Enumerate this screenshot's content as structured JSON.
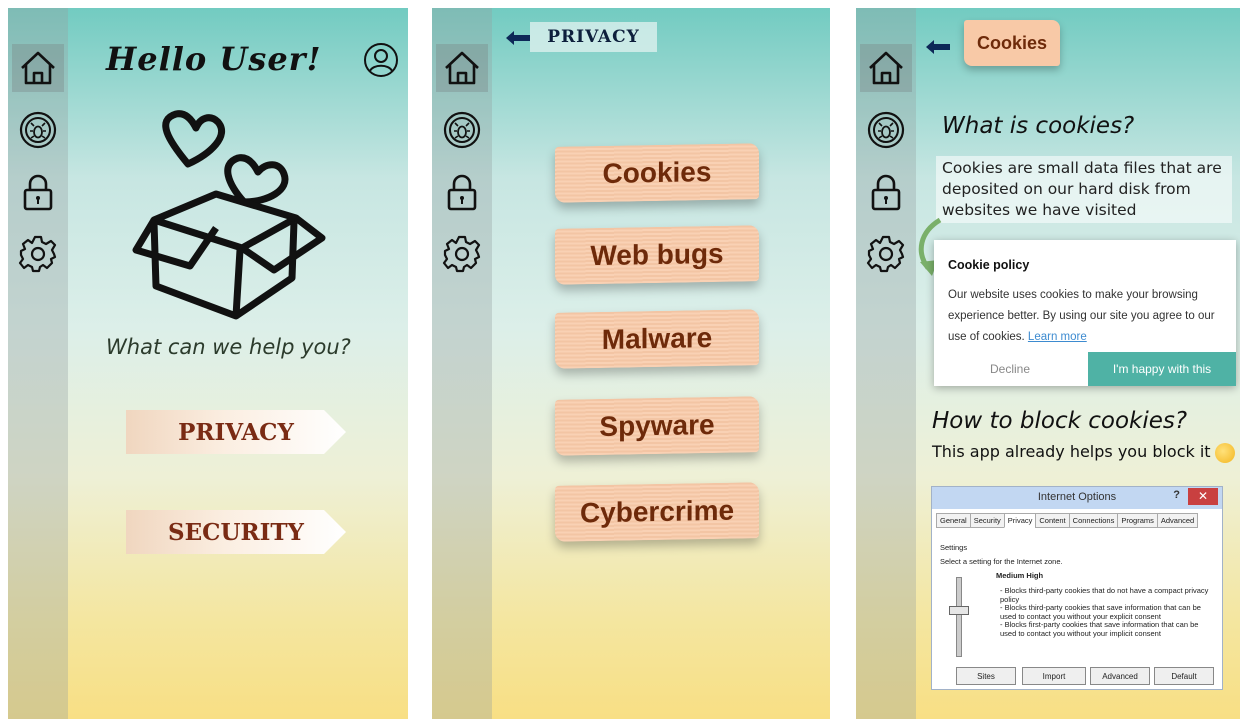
{
  "screen_home": {
    "greeting": "Hello User!",
    "help_text": "What can we help you?",
    "privacy_button": "PRIVACY",
    "security_button": "SECURITY"
  },
  "screen_privacy": {
    "page_tag": "PRIVACY",
    "topics": [
      "Cookies",
      "Web bugs",
      "Malware",
      "Spyware",
      "Cybercrime"
    ]
  },
  "screen_cookies": {
    "title": "Cookies",
    "heading_what": "What is cookies?",
    "definition": "Cookies are small data files that are deposited on our hard disk from websites we have visited",
    "cookie_policy": {
      "title": "Cookie policy",
      "text": "Our website uses cookies to make your browsing experience better. By using our site you agree to our use of cookies.",
      "link": "Learn more",
      "decline": "Decline",
      "accept": "I'm happy with this"
    },
    "heading_block": "How to block cookies?",
    "subtext": "This app already helps you block it",
    "internet_options": {
      "title": "Internet Options",
      "help": "?",
      "close": "✕",
      "tabs": [
        "General",
        "Security",
        "Privacy",
        "Content",
        "Connections",
        "Programs",
        "Advanced"
      ],
      "active_tab": "Privacy",
      "settings_label": "Settings",
      "zone_prompt": "Select a setting for the Internet zone.",
      "level": "Medium High",
      "descriptions": [
        "- Blocks third-party cookies that do not have a compact privacy policy",
        "- Blocks third-party cookies that save information that can be used to contact you without your explicit consent",
        "- Blocks first-party cookies that save information that can be used to contact you without your implicit consent"
      ],
      "buttons": [
        "Sites",
        "Import",
        "Advanced",
        "Default"
      ]
    }
  },
  "icons": [
    "home-icon",
    "bug-shield-icon",
    "lock-icon",
    "gear-icon",
    "user-avatar-icon",
    "back-arrow-icon",
    "heart-gift-box-icon"
  ]
}
